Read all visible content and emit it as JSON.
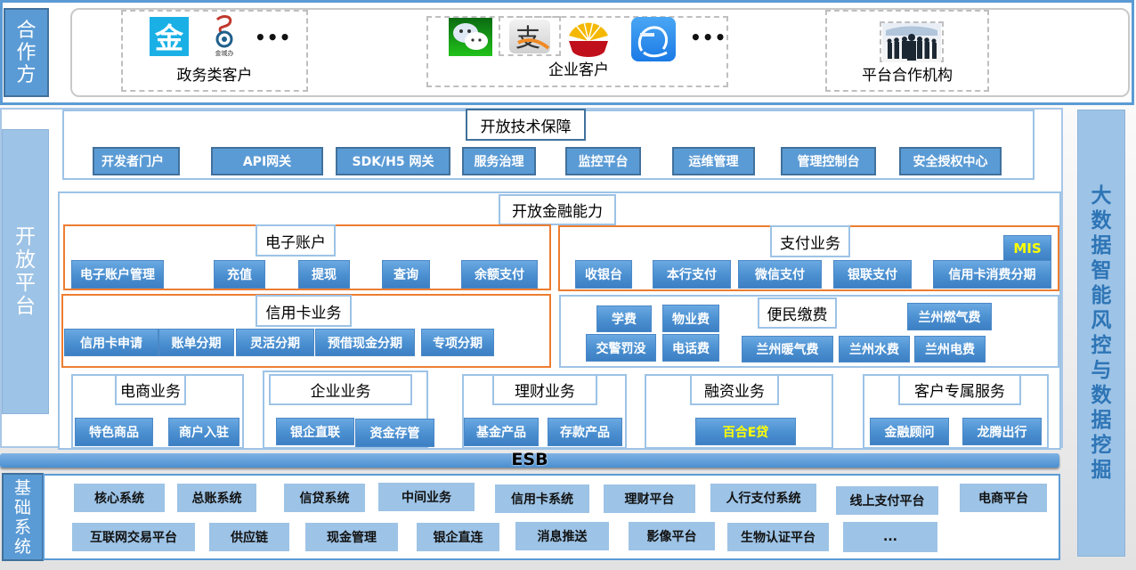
{
  "partners": {
    "side_label": [
      "合",
      "作",
      "方"
    ],
    "groups": {
      "government": {
        "label": "政务类客户",
        "icons": [
          "jin-app-icon",
          "jinchengban-icon"
        ],
        "icon_texts": {
          "jin": "金",
          "jinchengban": "金城办"
        },
        "more": "•••"
      },
      "enterprise": {
        "label": "企业客户",
        "icons": [
          "wechat-icon",
          "alipay-icon",
          "cnpc-icon",
          "jinqiao-software-icon"
        ],
        "icon_texts": {
          "alipay": "支"
        },
        "more": "•••"
      },
      "platform": {
        "label": "平台合作机构",
        "icons": [
          "business-people-icon"
        ]
      }
    }
  },
  "open_platform": {
    "side_label": [
      "开",
      "放",
      "平",
      "台"
    ],
    "tech": {
      "title": "开放技术保障",
      "items": [
        "开发者门户",
        "API网关",
        "SDK/H5 网关",
        "服务治理",
        "监控平台",
        "运维管理",
        "管理控制台",
        "安全授权中心"
      ]
    },
    "finance": {
      "title": "开放金融能力",
      "e_account": {
        "title": "电子账户",
        "items": [
          "电子账户管理",
          "充值",
          "提现",
          "查询",
          "余额支付"
        ]
      },
      "payment": {
        "title": "支付业务",
        "items": [
          "收银台",
          "本行支付",
          "微信支付",
          "银联支付",
          "信用卡消费分期"
        ],
        "badge": "MIS"
      },
      "credit_card": {
        "title": "信用卡业务",
        "items": [
          "信用卡申请",
          "账单分期",
          "灵活分期",
          "预借现金分期",
          "专项分期"
        ]
      },
      "utility": {
        "title": "便民缴费",
        "items": [
          "学费",
          "物业费",
          "兰州燃气费",
          "交警罚没",
          "电话费",
          "兰州暖气费",
          "兰州水费",
          "兰州电费"
        ]
      },
      "ecommerce": {
        "title": "电商业务",
        "items": [
          "特色商品",
          "商户入驻"
        ]
      },
      "enterprise_biz": {
        "title": "企业业务",
        "items": [
          "银企直联",
          "资金存管"
        ]
      },
      "wealth": {
        "title": "理财业务",
        "items": [
          "基金产品",
          "存款产品"
        ]
      },
      "financing": {
        "title": "融资业务",
        "items": [
          "百合E贷"
        ]
      },
      "customer": {
        "title": "客户专属服务",
        "items": [
          "金融顾问",
          "龙腾出行"
        ]
      }
    }
  },
  "esb": {
    "label": "ESB"
  },
  "base_systems": {
    "side_label": [
      "基",
      "础",
      "系",
      "统"
    ],
    "row1": [
      "核心系统",
      "总账系统",
      "信贷系统",
      "中间业务",
      "信用卡系统",
      "理财平台",
      "人行支付系统",
      "线上支付平台",
      "电商平台"
    ],
    "row2": [
      "互联网交易平台",
      "供应链",
      "现金管理",
      "银企直连",
      "消息推送",
      "影像平台",
      "生物认证平台",
      "..."
    ]
  },
  "bigdata": {
    "label": [
      "大",
      "数",
      "据",
      "智",
      "能",
      "风",
      "控",
      "与",
      "数",
      "据",
      "挖",
      "掘"
    ]
  },
  "colors": {
    "primary_blue": "#5b9bd5",
    "light_blue": "#9dc3e6",
    "dark_border": "#41719c",
    "orange_frame": "#ed7d31",
    "highlight_yellow": "#ffff00",
    "bigdata_text": "#2e75b6"
  }
}
